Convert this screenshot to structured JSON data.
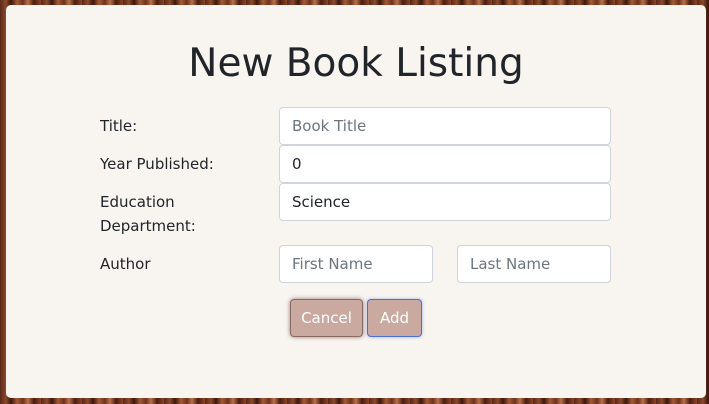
{
  "form": {
    "heading": "New Book Listing",
    "title_label": "Title:",
    "title_placeholder": "Book Title",
    "title_value": "",
    "year_label": "Year Published:",
    "year_value": "0",
    "department_label_line1": "Education",
    "department_label_line2": "Department:",
    "department_value": "Science",
    "author_label": "Author",
    "first_name_placeholder": "First Name",
    "last_name_placeholder": "Last Name",
    "cancel_label": "Cancel",
    "add_label": "Add"
  },
  "colors": {
    "card_background": "#f8f4f0",
    "button_background": "#c9a9a0",
    "add_focus_border": "#4a6fd8"
  }
}
